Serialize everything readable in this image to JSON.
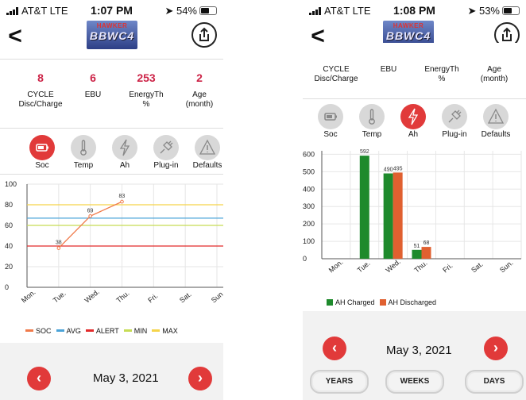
{
  "left": {
    "status": {
      "carrier": "AT&T  LTE",
      "time": "1:07 PM",
      "battery": "54%"
    },
    "stats": [
      {
        "value": "8",
        "label1": "CYCLE",
        "label2": "Disc/Charge"
      },
      {
        "value": "6",
        "label1": "EBU",
        "label2": ""
      },
      {
        "value": "253",
        "label1": "EnergyTh",
        "label2": "%"
      },
      {
        "value": "2",
        "label1": "Age",
        "label2": "(month)"
      }
    ],
    "icons": [
      {
        "label": "Soc",
        "name": "soc"
      },
      {
        "label": "Temp",
        "name": "temp"
      },
      {
        "label": "Ah",
        "name": "ah"
      },
      {
        "label": "Plug-in",
        "name": "plugin"
      },
      {
        "label": "Defaults",
        "name": "defaults"
      }
    ],
    "active_icon": "soc",
    "date": "May 3, 2021",
    "legend": [
      "SOC",
      "AVG",
      "ALERT",
      "MIN",
      "MAX"
    ]
  },
  "right": {
    "status": {
      "carrier": "AT&T  LTE",
      "time": "1:08 PM",
      "battery": "53%"
    },
    "stats": [
      {
        "value": "8",
        "label1": "CYCLE",
        "label2": "Disc/Charge"
      },
      {
        "value": "6",
        "label1": "EBU",
        "label2": ""
      },
      {
        "value": "253",
        "label1": "EnergyTh",
        "label2": "%"
      },
      {
        "value": "2",
        "label1": "Age",
        "label2": "(month)"
      }
    ],
    "icons": [
      {
        "label": "Soc",
        "name": "soc"
      },
      {
        "label": "Temp",
        "name": "temp"
      },
      {
        "label": "Ah",
        "name": "ah"
      },
      {
        "label": "Plug-in",
        "name": "plugin"
      },
      {
        "label": "Defaults",
        "name": "defaults"
      }
    ],
    "active_icon": "ah",
    "date": "May 3, 2021",
    "segments": [
      "YEARS",
      "WEEKS",
      "DAYS"
    ]
  },
  "logo": {
    "line1": "HAWKER",
    "line2": "BBWC4"
  },
  "colors": {
    "accent": "#cc2246",
    "active": "#e13a3a",
    "ah_charged": "#1e8a2c",
    "ah_discharged": "#e06030",
    "soc": "#f07a4a",
    "avg": "#4aa3d8",
    "alert": "#e22a2a",
    "min": "#c6dc55",
    "max": "#f5d44a"
  },
  "chart_data": [
    {
      "type": "line",
      "categories": [
        "Mon.",
        "Tue.",
        "Wed.",
        "Thu.",
        "Fri.",
        "Sat.",
        "Sun."
      ],
      "series": [
        {
          "name": "SOC",
          "values": [
            null,
            38,
            69,
            83,
            null,
            null,
            null
          ]
        },
        {
          "name": "AVG",
          "values": [
            67,
            67,
            67,
            67,
            67,
            67,
            67
          ]
        },
        {
          "name": "ALERT",
          "values": [
            40,
            40,
            40,
            40,
            40,
            40,
            40
          ]
        },
        {
          "name": "MIN",
          "values": [
            60,
            60,
            60,
            60,
            60,
            60,
            60
          ]
        },
        {
          "name": "MAX",
          "values": [
            80,
            80,
            80,
            80,
            80,
            80,
            80
          ]
        }
      ],
      "data_labels": [
        "",
        "38",
        "69",
        "83",
        "",
        "",
        ""
      ],
      "yticks": [
        0,
        20,
        40,
        60,
        80,
        100
      ],
      "ylim": [
        0,
        100
      ],
      "legend": "bottom"
    },
    {
      "type": "bar",
      "categories": [
        "Mon.",
        "Tue.",
        "Wed.",
        "Thu.",
        "Fri.",
        "Sat.",
        "Sun."
      ],
      "series": [
        {
          "name": "AH Charged",
          "values": [
            null,
            592,
            490,
            51,
            null,
            null,
            null
          ]
        },
        {
          "name": "AH Discharged",
          "values": [
            null,
            null,
            495,
            68,
            null,
            null,
            null
          ]
        }
      ],
      "yticks": [
        0,
        100,
        200,
        300,
        400,
        500,
        600
      ],
      "ylim": [
        0,
        620
      ],
      "legend": "bottom"
    }
  ]
}
